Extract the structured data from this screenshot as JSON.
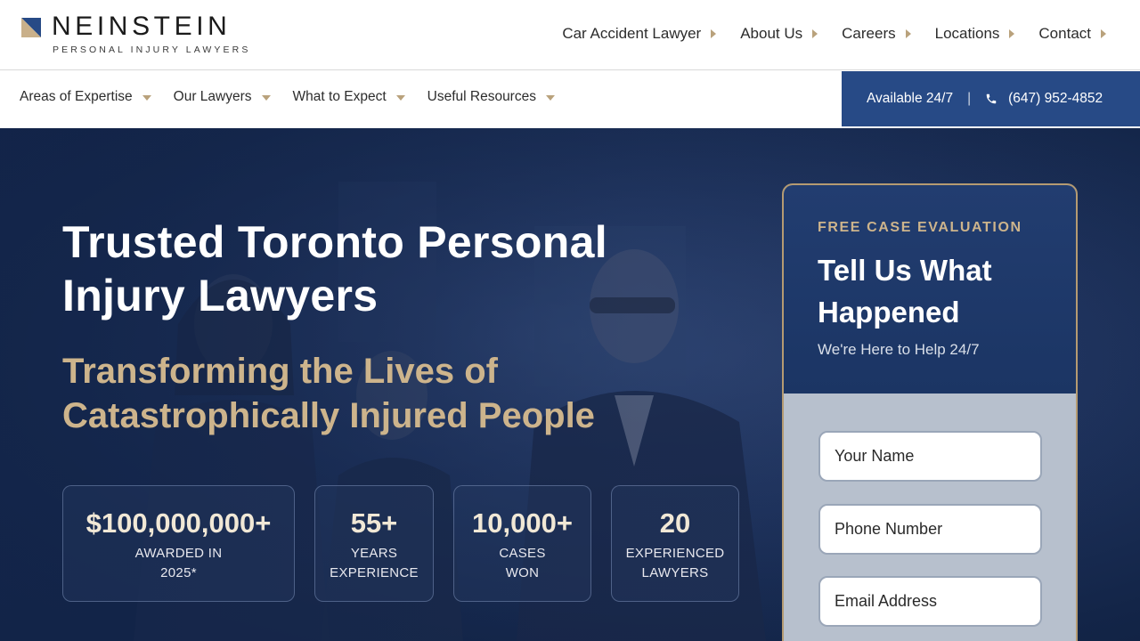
{
  "brand": {
    "name": "NEINSTEIN",
    "tagline": "PERSONAL INJURY LAWYERS",
    "mark_color": "#274a86"
  },
  "top_nav": [
    {
      "label": "Car Accident Lawyer"
    },
    {
      "label": "About Us"
    },
    {
      "label": "Careers"
    },
    {
      "label": "Locations"
    },
    {
      "label": "Contact"
    }
  ],
  "sub_nav": [
    {
      "label": "Areas of Expertise"
    },
    {
      "label": "Our Lawyers"
    },
    {
      "label": "What to Expect"
    },
    {
      "label": "Useful Resources"
    }
  ],
  "cta": {
    "availability": "Available 24/7",
    "separator": "|",
    "phone": "(647) 952-4852",
    "icon": "phone-icon"
  },
  "hero": {
    "title": "Trusted Toronto Personal Injury Lawyers",
    "subtitle": "Transforming the Lives of Catastrophically Injured People",
    "stats": [
      {
        "value": "$100,000,000+",
        "label_line1": "AWARDED IN",
        "label_line2": "2025*"
      },
      {
        "value": "55+",
        "label_line1": "YEARS",
        "label_line2": "EXPERIENCE"
      },
      {
        "value": "10,000+",
        "label_line1": "CASES",
        "label_line2": "WON"
      },
      {
        "value": "20",
        "label_line1": "EXPERIENCED",
        "label_line2": "LAWYERS"
      }
    ]
  },
  "form": {
    "kicker": "FREE CASE EVALUATION",
    "title": "Tell Us What Happened",
    "tagline": "We're Here to Help 24/7",
    "fields": [
      {
        "placeholder": "Your Name",
        "value": ""
      },
      {
        "placeholder": "Phone Number",
        "value": ""
      },
      {
        "placeholder": "Email Address",
        "value": ""
      }
    ]
  },
  "colors": {
    "accent_gold": "#cdb48c",
    "navy": "#132548",
    "cta_blue": "#274a86"
  }
}
